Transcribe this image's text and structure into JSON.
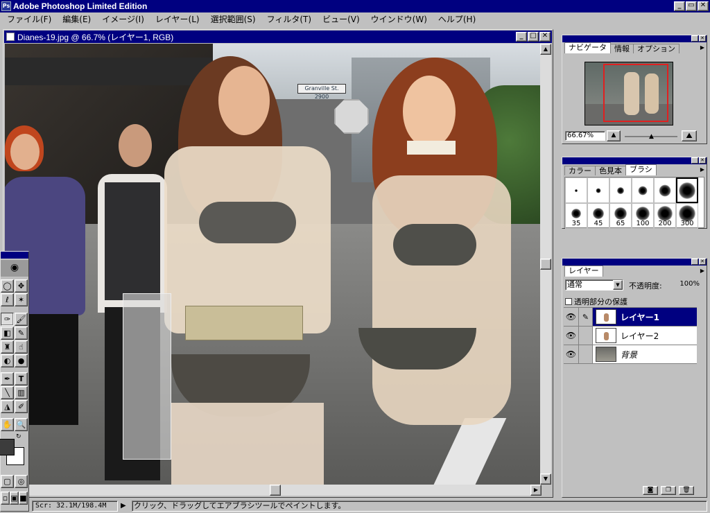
{
  "app": {
    "title": "Adobe Photoshop Limited Edition",
    "icon": "ps-icon",
    "caption_buttons": [
      "_",
      "▭",
      "✕"
    ]
  },
  "menu": [
    "ファイル(F)",
    "編集(E)",
    "イメージ(I)",
    "レイヤー(L)",
    "選択範囲(S)",
    "フィルタ(T)",
    "ビュー(V)",
    "ウインドウ(W)",
    "ヘルプ(H)"
  ],
  "document": {
    "title": "Dianes-19.jpg @ 66.7% (レイヤー1, RGB)",
    "caption_buttons": [
      "_",
      "□",
      "✕"
    ],
    "street_sign": "Granville St. 2900"
  },
  "navigator": {
    "tabs": [
      "ナビゲータ",
      "情報",
      "オプション"
    ],
    "zoom": "66.67%",
    "zoom_fraction": 0.5,
    "view_box_color": "#e02020"
  },
  "brushes": {
    "tabs": [
      "カラー",
      "色見本",
      "ブラシ"
    ],
    "sizes": [
      "",
      "",
      "",
      "",
      "",
      "",
      "35",
      "45",
      "65",
      "100",
      "200",
      "300"
    ],
    "selected_index": 5
  },
  "layers": {
    "tab": "レイヤー",
    "blend_mode": "通常",
    "opacity_label": "不透明度:",
    "opacity_value": "100%",
    "preserve_transparency": "透明部分の保護",
    "items": [
      {
        "name": "レイヤー1",
        "active": true
      },
      {
        "name": "レイヤー2",
        "active": false
      },
      {
        "name": "背景",
        "active": false
      }
    ]
  },
  "colors": {
    "foreground": "#3c3c3c",
    "background": "#ffffff",
    "titlebar": "#000080"
  },
  "status": {
    "info": "Scr: 32.1M/198.4M",
    "hint": "クリック、ドラッグしてエアブラシツールでペイントします。"
  }
}
